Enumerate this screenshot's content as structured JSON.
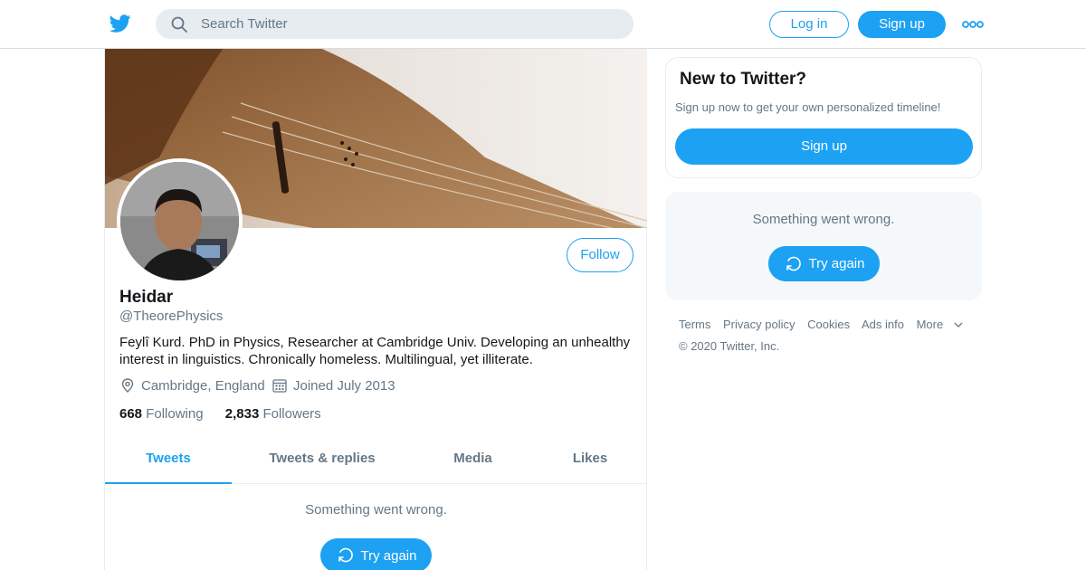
{
  "header": {
    "search_placeholder": "Search Twitter",
    "login_label": "Log in",
    "signup_label": "Sign up",
    "logo_icon": "twitter-bird-icon",
    "more_icon": "more-dots-icon"
  },
  "profile": {
    "follow_label": "Follow",
    "name": "Heidar",
    "handle": "@TheorePhysics",
    "bio": "Feylî Kurd. PhD in Physics, Researcher at Cambridge Univ. Developing an unhealthy interest in linguistics. Chronically homeless. Multilingual, yet illiterate.",
    "location": "Cambridge, England",
    "joined": "Joined July 2013",
    "following_count": "668",
    "following_label": "Following",
    "followers_count": "2,833",
    "followers_label": "Followers"
  },
  "tabs": [
    {
      "label": "Tweets",
      "active": true
    },
    {
      "label": "Tweets & replies",
      "active": false
    },
    {
      "label": "Media",
      "active": false
    },
    {
      "label": "Likes",
      "active": false
    }
  ],
  "timeline": {
    "error_message": "Something went wrong.",
    "try_again_label": "Try again"
  },
  "sidebar": {
    "new_title": "New to Twitter?",
    "new_subtitle": "Sign up now to get your own personalized timeline!",
    "signup_label": "Sign up",
    "error_message": "Something went wrong.",
    "try_again_label": "Try again"
  },
  "footer": {
    "links": [
      "Terms",
      "Privacy policy",
      "Cookies",
      "Ads info",
      "More"
    ],
    "copyright": "© 2020 Twitter, Inc."
  },
  "colors": {
    "accent": "#1da1f2",
    "secondary_text": "#657786",
    "border": "#e6ecf0"
  }
}
